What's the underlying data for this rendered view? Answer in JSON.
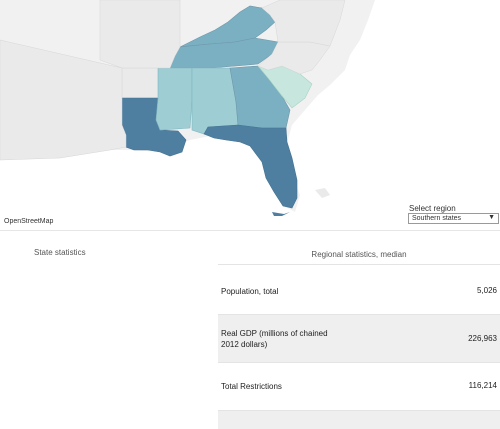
{
  "map": {
    "attribution": "OpenStreetMap",
    "colors": {
      "land": "#e9e9e9",
      "water": "#ffffff",
      "dark": "#4e7fa1",
      "mid": "#7ab0c2",
      "light": "#9ecdd3",
      "pale": "#c7e6dd"
    }
  },
  "filter": {
    "label": "Select region",
    "selected": "Southern states"
  },
  "state_panel": {
    "title": "State statistics"
  },
  "regional_panel": {
    "title": "Regional statistics, median",
    "rows": [
      {
        "label": "Population, total",
        "value": "5,026"
      },
      {
        "label": "Real GDP (millions of chained 2012 dollars)",
        "value": "226,963"
      },
      {
        "label": "Total Restrictions",
        "value": "116,214"
      },
      {
        "label": "",
        "value": ""
      }
    ]
  }
}
